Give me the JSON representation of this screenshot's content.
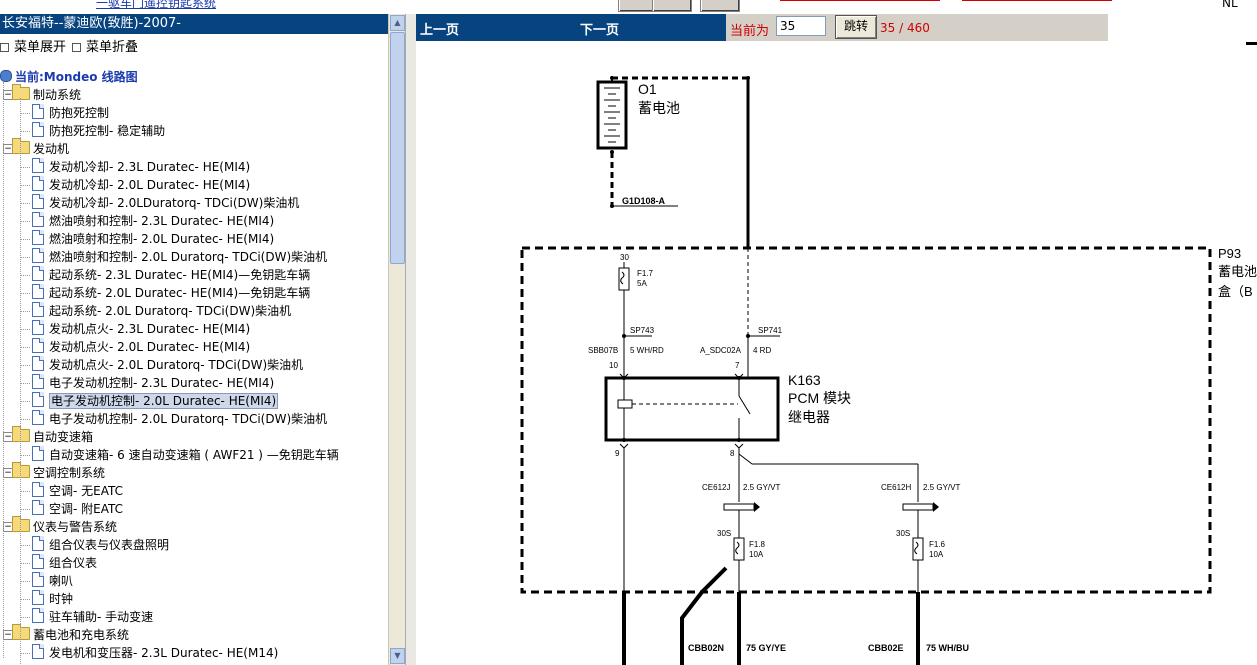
{
  "window_top": {
    "link_text": "一驱车门遥控钥匙系统",
    "red_link_1": "",
    "red_link_2": "",
    "corner_text": "NL"
  },
  "sidebar": {
    "title": "长安福特--蒙迪欧(致胜)-2007-",
    "expand_label": "菜单展开",
    "collapse_label": "菜单折叠",
    "current_label": "当前:Mondeo 线路图",
    "items": [
      {
        "label": "制动系统",
        "type": "folder",
        "level": 1
      },
      {
        "label": "防抱死控制",
        "type": "doc",
        "level": 2
      },
      {
        "label": "防抱死控制- 稳定辅助",
        "type": "doc",
        "level": 2
      },
      {
        "label": "发动机",
        "type": "folder",
        "level": 1
      },
      {
        "label": "发动机冷却- 2.3L Duratec- HE(MI4)",
        "type": "doc",
        "level": 2
      },
      {
        "label": "发动机冷却- 2.0L Duratec- HE(MI4)",
        "type": "doc",
        "level": 2
      },
      {
        "label": "发动机冷却- 2.0LDuratorq- TDCi(DW)柴油机",
        "type": "doc",
        "level": 2
      },
      {
        "label": "燃油喷射和控制- 2.3L Duratec- HE(MI4)",
        "type": "doc",
        "level": 2
      },
      {
        "label": "燃油喷射和控制- 2.0L Duratec- HE(MI4)",
        "type": "doc",
        "level": 2
      },
      {
        "label": "燃油喷射和控制- 2.0L Duratorq- TDCi(DW)柴油机",
        "type": "doc",
        "level": 2
      },
      {
        "label": "起动系统- 2.3L Duratec- HE(MI4)—免钥匙车辆",
        "type": "doc",
        "level": 2
      },
      {
        "label": "起动系统- 2.0L Duratec- HE(MI4)—免钥匙车辆",
        "type": "doc",
        "level": 2
      },
      {
        "label": "起动系统- 2.0L Duratorq- TDCi(DW)柴油机",
        "type": "doc",
        "level": 2
      },
      {
        "label": "发动机点火- 2.3L Duratec- HE(MI4)",
        "type": "doc",
        "level": 2
      },
      {
        "label": "发动机点火- 2.0L Duratec- HE(MI4)",
        "type": "doc",
        "level": 2
      },
      {
        "label": "发动机点火- 2.0L Duratorq- TDCi(DW)柴油机",
        "type": "doc",
        "level": 2
      },
      {
        "label": "电子发动机控制- 2.3L Duratec- HE(MI4)",
        "type": "doc",
        "level": 2
      },
      {
        "label": "电子发动机控制- 2.0L Duratec- HE(MI4)",
        "type": "doc",
        "level": 2,
        "selected": true
      },
      {
        "label": "电子发动机控制- 2.0L Duratorq- TDCi(DW)柴油机",
        "type": "doc",
        "level": 2
      },
      {
        "label": "自动变速箱",
        "type": "folder",
        "level": 1
      },
      {
        "label": "自动变速箱- 6 速自动变速箱 ( AWF21 ) —免钥匙车辆",
        "type": "doc",
        "level": 2
      },
      {
        "label": "空调控制系统",
        "type": "folder",
        "level": 1
      },
      {
        "label": "空调- 无EATC",
        "type": "doc",
        "level": 2
      },
      {
        "label": "空调- 附EATC",
        "type": "doc",
        "level": 2
      },
      {
        "label": "仪表与警告系统",
        "type": "folder",
        "level": 1
      },
      {
        "label": "组合仪表与仪表盘照明",
        "type": "doc",
        "level": 2
      },
      {
        "label": "组合仪表",
        "type": "doc",
        "level": 2
      },
      {
        "label": "喇叭",
        "type": "doc",
        "level": 2
      },
      {
        "label": "时钟",
        "type": "doc",
        "level": 2
      },
      {
        "label": "驻车辅助- 手动变速",
        "type": "doc",
        "level": 2
      },
      {
        "label": "蓄电池和充电系统",
        "type": "folder",
        "level": 1
      },
      {
        "label": "发电机和变压器- 2.3L Duratec- HE(M14)",
        "type": "doc",
        "level": 2
      }
    ]
  },
  "nav": {
    "prev_label": "上一页",
    "next_label": "下一页",
    "current_label": "当前为",
    "page_input_value": "35",
    "go_label": "跳转",
    "page_count": "35 / 460"
  },
  "diagram": {
    "o1_code": "O1",
    "o1_name": "蓄电池",
    "ground_code": "G1D108-A",
    "p93_code": "P93",
    "p93_name_1": "蓄电池",
    "p93_name_2": "盒（B",
    "pin_30": "30",
    "fuse_f17": "F1.7",
    "fuse_f17_amp": "5A",
    "sp743": "SP743",
    "sp741": "SP741",
    "sbb07b": "SBB07B",
    "wire_5whrd": "5 WH/RD",
    "a_sdc02a": "A_SDC02A",
    "wire_4rd": "4 RD",
    "pin_10": "10",
    "pin_7": "7",
    "k163_code": "K163",
    "k163_name_1": "PCM 模块",
    "k163_name_2": "继电器",
    "pin_9": "9",
    "pin_8": "8",
    "ce612j": "CE612J",
    "wire_gyvt_1": "2.5 GY/VT",
    "ce612h": "CE612H",
    "wire_gyvt_2": "2.5 GY/VT",
    "pin_30s_1": "30S",
    "fuse_f18": "F1.8",
    "fuse_f18_amp": "10A",
    "pin_30s_2": "30S",
    "fuse_f16": "F1.6",
    "fuse_f16_amp": "10A",
    "bottom_1": "CBB02N",
    "bottom_2": "75 GY/YE",
    "bottom_3": "CBB02E",
    "bottom_4": "75 WH/BU"
  },
  "colors": {
    "header_blue": "#07447f",
    "nav_red": "#d00000",
    "tree_current": "#1c3ab0"
  }
}
